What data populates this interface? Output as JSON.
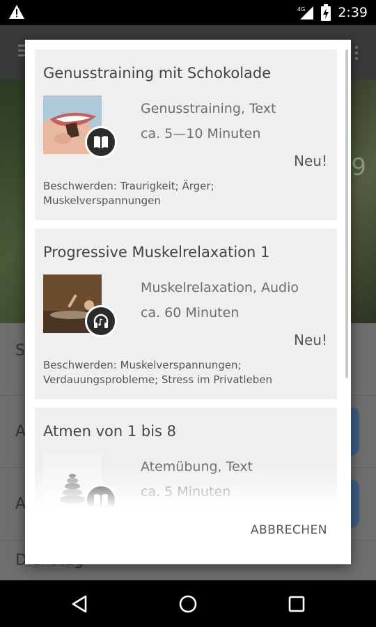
{
  "status_bar": {
    "time": "2:39",
    "network": "4G",
    "icons": [
      "warning-icon",
      "signal-icon",
      "battery-charging-icon"
    ]
  },
  "background": {
    "partial_number": "9",
    "row_letters": [
      "S",
      "A",
      "A",
      "Dienstag"
    ]
  },
  "dialog": {
    "cards": [
      {
        "title": "Genusstraining mit Schokolade",
        "type": "Genusstraining, Text",
        "duration": "ca. 5—10 Minuten",
        "new_label": "Neu!",
        "complaints": "Beschwerden: Traurigkeit; Ärger; Muskelverspannungen",
        "media_icon": "book-icon"
      },
      {
        "title": "Progressive Muskelrelaxation 1",
        "type": "Muskelrelaxation, Audio",
        "duration": "ca. 60 Minuten",
        "new_label": "Neu!",
        "complaints": "Beschwerden: Muskelverspannungen; Verdauungsprobleme; Stress im Privatleben",
        "media_icon": "headphones-icon"
      },
      {
        "title": "Atmen von 1 bis 8",
        "type": "Atemübung, Text",
        "duration": "ca. 5 Minuten",
        "media_icon": "book-icon"
      }
    ],
    "cancel_label": "ABBRECHEN"
  },
  "colors": {
    "card_bg": "#efefef",
    "dialog_bg": "#ffffff",
    "scrim": "#5b5b5b",
    "badge_bg": "#2b2b2b"
  }
}
